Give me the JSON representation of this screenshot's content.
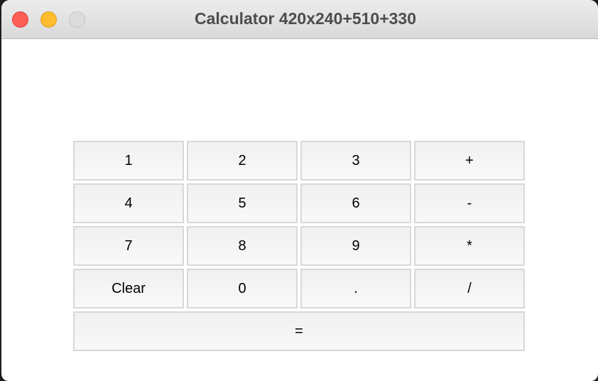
{
  "window": {
    "title": "Calculator 420x240+510+330"
  },
  "keypad": {
    "rows": [
      [
        "1",
        "2",
        "3",
        "+"
      ],
      [
        "4",
        "5",
        "6",
        "-"
      ],
      [
        "7",
        "8",
        "9",
        "*"
      ],
      [
        "Clear",
        "0",
        ".",
        "/"
      ]
    ],
    "equals": "="
  }
}
